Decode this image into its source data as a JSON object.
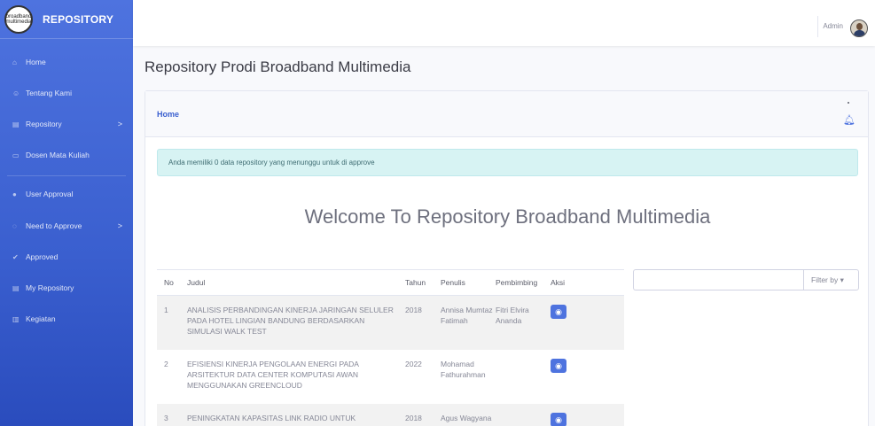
{
  "brand": {
    "logo_text": "broadband multimedia",
    "name": "REPOSITORY"
  },
  "sidebar": {
    "items": [
      {
        "label": "Home",
        "icon": "home-icon"
      },
      {
        "label": "Tentang Kami",
        "icon": "users-icon"
      },
      {
        "label": "Repository",
        "icon": "file-icon",
        "chevron": ">"
      },
      {
        "label": "Dosen Mata Kuliah",
        "icon": "book-icon"
      },
      {
        "label": "User Approval",
        "icon": "user-icon"
      },
      {
        "label": "Need to Approve",
        "icon": "spinner-icon",
        "chevron": ">"
      },
      {
        "label": "Approved",
        "icon": "check-icon"
      },
      {
        "label": "My Repository",
        "icon": "file-icon"
      },
      {
        "label": "Kegiatan",
        "icon": "building-icon"
      }
    ]
  },
  "topbar": {
    "user": "Admin"
  },
  "page_title": "Repository Prodi Broadband Multimedia",
  "breadcrumb": "Home",
  "alert": "Anda memiliki 0 data repository yang menunggu untuk di approve",
  "welcome": "Welcome To Repository Broadband Multimedia",
  "table": {
    "headers": {
      "no": "No",
      "judul": "Judul",
      "tahun": "Tahun",
      "penulis": "Penulis",
      "pembimbing": "Pembimbing",
      "aksi": "Aksi"
    },
    "rows": [
      {
        "no": "1",
        "judul": "ANALISIS PERBANDINGAN KINERJA JARINGAN SELULER PADA HOTEL LINGIAN BANDUNG BERDASARKAN SIMULASI WALK TEST",
        "tahun": "2018",
        "penulis": "Annisa Mumtaz Fatimah",
        "pembimbing": "Fitri Elvira Ananda"
      },
      {
        "no": "2",
        "judul": "EFISIENSI KINERJA PENGOLAAN ENERGI PADA ARSITEKTUR DATA CENTER KOMPUTASI AWAN MENGGUNAKAN GREENCLOUD",
        "tahun": "2022",
        "penulis": "Mohamad Fathurahman",
        "pembimbing": ""
      },
      {
        "no": "3",
        "judul": "PENINGKATAN KAPASITAS LINK RADIO UNTUK",
        "tahun": "2018",
        "penulis": "Agus Wagyana",
        "pembimbing": ""
      }
    ]
  },
  "filter_label": "Filter by ▾",
  "colors": {
    "primary": "#4e73df",
    "alert_bg": "#d7f3f3"
  }
}
